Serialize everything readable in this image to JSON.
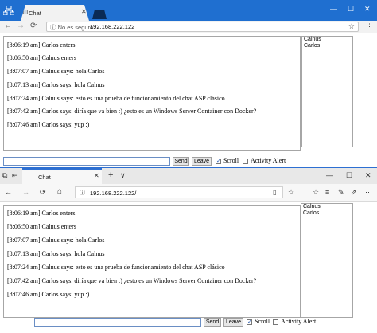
{
  "chrome": {
    "tab_title": "Chat",
    "window_controls": {
      "minimize": "—",
      "maximize": "☐",
      "close": "✕"
    },
    "back_icon": "←",
    "forward_icon": "→",
    "reload_icon": "⟳",
    "secure_label": "ⓘ No es seguro",
    "url": "192.168.222.122",
    "accent_color": "#1f6fd0"
  },
  "edge": {
    "tab_title": "Chat",
    "new_tab_icon": "+",
    "tab_dropdown_icon": "∨",
    "window_controls": {
      "minimize": "—",
      "maximize": "☐",
      "close": "✕"
    },
    "back_icon": "←",
    "forward_icon": "→",
    "reload_icon": "⟳",
    "home_icon": "⌂",
    "url": "192.168.222.122/",
    "accent_color": "#2d6fd2"
  },
  "chat": {
    "messages": [
      "[8:06:19 am] Carlos enters",
      "[8:06:50 am] Calnus enters",
      "[8:07:07 am] Calnus says: hola Carlos",
      "[8:07:13 am] Carlos says: hola Calnus",
      "[8:07:24 am] Calnus says: esto es una prueba de funcionamiento del chat ASP clásico",
      "[8:07:42 am] Carlos says: diría que va bien :) ¿esto es un Windows Server Container con Docker?",
      "[8:07:46 am] Carlos says: yup :)"
    ],
    "users": [
      "Calnus",
      "Carlos"
    ],
    "message_input_value": "",
    "send_label": "Send",
    "leave_label": "Leave",
    "scroll_label": "Scroll",
    "scroll_checked": true,
    "activity_alert_label": "Activity Alert",
    "activity_alert_checked": false
  }
}
